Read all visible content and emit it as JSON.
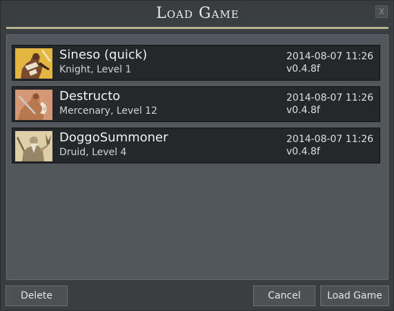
{
  "dialog": {
    "title": "Load Game",
    "close_label": "X"
  },
  "saves": [
    {
      "name": "Sineso (quick)",
      "subtitle": "Knight, Level 1",
      "date": "2014-08-07 11:26",
      "version": "v0.4.8f",
      "portrait_bg": "#e2b640",
      "portrait_icon": "knight-portrait-icon"
    },
    {
      "name": "Destructo",
      "subtitle": "Mercenary, Level 12",
      "date": "2014-08-07 11:26",
      "version": "v0.4.8f",
      "portrait_bg": "#d49878",
      "portrait_icon": "mercenary-portrait-icon"
    },
    {
      "name": "DoggoSummoner",
      "subtitle": "Druid, Level 4",
      "date": "2014-08-07 11:26",
      "version": "v0.4.8f",
      "portrait_bg": "#ddd0a8",
      "portrait_icon": "druid-portrait-icon"
    }
  ],
  "buttons": {
    "delete": "Delete",
    "cancel": "Cancel",
    "load": "Load Game"
  }
}
